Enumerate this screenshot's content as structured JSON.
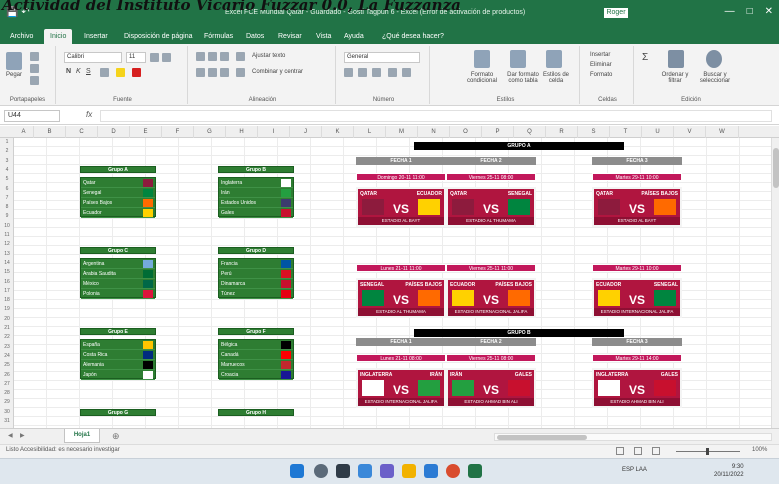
{
  "heading": "Actividad del Instituto Vicario Fuzzar 0.0, La Fuzzanza",
  "window": {
    "title": "Excel FCE Mundial Qatar - Guardado - Gosti Tagpuh 6 - Excel (Error de activación de productos)",
    "user": "Roger",
    "controls": [
      "—",
      "□",
      "✕"
    ]
  },
  "tabs": [
    "Archivo",
    "Inicio",
    "Insertar",
    "Disposición de página",
    "Fórmulas",
    "Datos",
    "Revisar",
    "Vista",
    "Ayuda",
    "¿Qué desea hacer?"
  ],
  "ribbon": {
    "font_name": "Calibri",
    "font_size": "11",
    "number_format": "General",
    "wrap_text": "Ajustar texto",
    "merge": "Combinar y centrar",
    "groups": [
      "Portapapeles",
      "Fuente",
      "Alineación",
      "Número",
      "Estilos",
      "Celdas",
      "Edición"
    ],
    "styles": [
      "Formato condicional",
      "Dar formato como tabla",
      "Estilos de celda"
    ],
    "cells": [
      "Insertar",
      "Eliminar",
      "Formato"
    ],
    "editing": [
      "Ordenar y filtrar",
      "Buscar y seleccionar"
    ],
    "paste": "Pegar"
  },
  "formula_bar": {
    "name_box": "U44",
    "fx": "fx"
  },
  "columns": [
    "A",
    "B",
    "C",
    "D",
    "E",
    "F",
    "G",
    "H",
    "I",
    "J",
    "K",
    "L",
    "M",
    "N",
    "O",
    "P",
    "Q",
    "R",
    "S",
    "T",
    "U",
    "V",
    "W"
  ],
  "rows": [
    "1",
    "2",
    "3",
    "4",
    "5",
    "6",
    "7",
    "8",
    "9",
    "10",
    "11",
    "12",
    "13",
    "14",
    "15",
    "16",
    "17",
    "18",
    "19",
    "20",
    "21",
    "22",
    "23",
    "24",
    "25",
    "26",
    "27",
    "28",
    "29",
    "30",
    "31"
  ],
  "groups": [
    {
      "title": "Grupo A",
      "teams": [
        "Qatar",
        "Senegal",
        "Países Bajos",
        "Ecuador"
      ],
      "flags": [
        "#8d1b3d",
        "#00853f",
        "#ff6a00",
        "#ffd100"
      ]
    },
    {
      "title": "Grupo B",
      "teams": [
        "Inglaterra",
        "Irán",
        "Estados Unidos",
        "Gales"
      ],
      "flags": [
        "#ffffff",
        "#239f40",
        "#3c3b6e",
        "#c8102e"
      ]
    },
    {
      "title": "Grupo C",
      "teams": [
        "Argentina",
        "Arabia Saudita",
        "México",
        "Polonia"
      ],
      "flags": [
        "#75aadb",
        "#006c35",
        "#006847",
        "#dc143c"
      ]
    },
    {
      "title": "Grupo D",
      "teams": [
        "Francia",
        "Perú",
        "Dinamarca",
        "Túnez"
      ],
      "flags": [
        "#0055a4",
        "#d91023",
        "#c8102e",
        "#e70013"
      ]
    },
    {
      "title": "Grupo E",
      "teams": [
        "España",
        "Costa Rica",
        "Alemania",
        "Japón"
      ],
      "flags": [
        "#ffc400",
        "#002b7f",
        "#000000",
        "#ffffff"
      ]
    },
    {
      "title": "Grupo F",
      "teams": [
        "Bélgica",
        "Canadá",
        "Marruecos",
        "Croacia"
      ],
      "flags": [
        "#000000",
        "#ff0000",
        "#c1272d",
        "#171796"
      ]
    },
    {
      "title": "Grupo G",
      "teams": [],
      "flags": []
    },
    {
      "title": "Grupo H",
      "teams": [],
      "flags": []
    }
  ],
  "sections": [
    "GRUPO A",
    "GRUPO B"
  ],
  "matches": [
    {
      "fecha": "FECHA 1",
      "date": "Domingo 20-11 11:00",
      "home": "QATAR",
      "away": "ECUADOR",
      "stadium": "ESTADIO AL BAYT",
      "home_flag": "#8d1b3d",
      "away_flag": "#ffd100"
    },
    {
      "fecha": "FECHA 2",
      "date": "Viernes 25-11 08:00",
      "home": "QATAR",
      "away": "SENEGAL",
      "stadium": "ESTADIO AL THUMAMA",
      "home_flag": "#8d1b3d",
      "away_flag": "#00853f"
    },
    {
      "fecha": "FECHA 3",
      "date": "Martes 29-11 10:00",
      "home": "QATAR",
      "away": "PAÍSES BAJOS",
      "stadium": "ESTADIO AL BAYT",
      "home_flag": "#8d1b3d",
      "away_flag": "#ff6a00"
    },
    {
      "fecha": "",
      "date": "Lunes 21-11 11:00",
      "home": "SENEGAL",
      "away": "PAÍSES BAJOS",
      "stadium": "ESTADIO AL THUMAMA",
      "home_flag": "#00853f",
      "away_flag": "#ff6a00"
    },
    {
      "fecha": "",
      "date": "Viernes 25-11 11:00",
      "home": "ECUADOR",
      "away": "PAÍSES BAJOS",
      "stadium": "ESTADIO INTERNACIONAL JALIFA",
      "home_flag": "#ffd100",
      "away_flag": "#ff6a00"
    },
    {
      "fecha": "",
      "date": "Martes 29-11 10:00",
      "home": "ECUADOR",
      "away": "SENEGAL",
      "stadium": "ESTADIO INTERNACIONAL JALIFA",
      "home_flag": "#ffd100",
      "away_flag": "#00853f"
    },
    {
      "fecha": "FECHA 1",
      "date": "Lunes 21-11 08:00",
      "home": "INGLATERRA",
      "away": "IRÁN",
      "stadium": "ESTADIO INTERNACIONAL JALIFA",
      "home_flag": "#ffffff",
      "away_flag": "#239f40"
    },
    {
      "fecha": "FECHA 2",
      "date": "Viernes 25-11 08:00",
      "home": "IRÁN",
      "away": "GALES",
      "stadium": "ESTADIO AHMAD BIN ALI",
      "home_flag": "#239f40",
      "away_flag": "#c8102e"
    },
    {
      "fecha": "FECHA 3",
      "date": "Martes 29-11 14:00",
      "home": "INGLATERRA",
      "away": "GALES",
      "stadium": "ESTADIO AHMAD BIN ALI",
      "home_flag": "#ffffff",
      "away_flag": "#c8102e"
    }
  ],
  "vs": "VS",
  "sheet_tab": "Hoja1",
  "status": {
    "left": "Listo   Accesibilidad: es necesario investigar",
    "zoom": "100%"
  },
  "taskbar": {
    "tray": "ESP  LAA",
    "time": "9:30",
    "date": "20/11/2022"
  },
  "colors": {
    "excel_green": "#217346",
    "group_green": "#2e7d32",
    "match_red": "#b0153f"
  }
}
